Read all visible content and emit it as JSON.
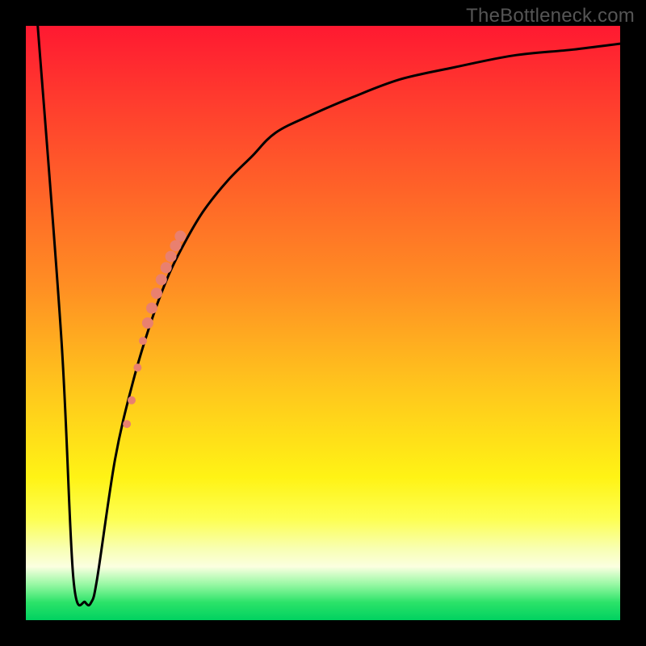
{
  "watermark": "TheBottleneck.com",
  "chart_data": {
    "type": "line",
    "title": "",
    "xlabel": "",
    "ylabel": "",
    "xlim": [
      0,
      100
    ],
    "ylim": [
      0,
      100
    ],
    "grid": false,
    "legend": false,
    "background_gradient": {
      "top": "#ff1931",
      "bottom": "#00d160",
      "stops": [
        {
          "pos": 0.0,
          "color": "#ff1931"
        },
        {
          "pos": 0.12,
          "color": "#ff3a2e"
        },
        {
          "pos": 0.28,
          "color": "#ff6428"
        },
        {
          "pos": 0.44,
          "color": "#ff8f23"
        },
        {
          "pos": 0.6,
          "color": "#ffc31d"
        },
        {
          "pos": 0.76,
          "color": "#fff315"
        },
        {
          "pos": 0.83,
          "color": "#fdff52"
        },
        {
          "pos": 0.88,
          "color": "#f8ffb3"
        },
        {
          "pos": 0.91,
          "color": "#fbffe0"
        },
        {
          "pos": 0.94,
          "color": "#97f8a3"
        },
        {
          "pos": 0.97,
          "color": "#2ce369"
        },
        {
          "pos": 1.0,
          "color": "#00d160"
        }
      ]
    },
    "series": [
      {
        "name": "bottleneck-curve",
        "color": "#000000",
        "stroke_width": 3,
        "x": [
          2,
          6,
          8,
          10,
          11,
          12,
          15,
          18,
          21,
          24,
          27,
          30,
          34,
          38,
          42,
          48,
          55,
          63,
          72,
          82,
          92,
          100
        ],
        "y": [
          100,
          47,
          7,
          3,
          3,
          7,
          27,
          40,
          50,
          58,
          64,
          69,
          74,
          78,
          82,
          85,
          88,
          91,
          93,
          95,
          96,
          97
        ]
      }
    ],
    "scatter": [
      {
        "name": "highlight-band",
        "color": "#e9806f",
        "radius_major": 7,
        "radius_minor": 5,
        "points": [
          {
            "x": 17.0,
            "y": 33.0,
            "r": 5
          },
          {
            "x": 17.8,
            "y": 37.0,
            "r": 5
          },
          {
            "x": 18.8,
            "y": 42.5,
            "r": 5
          },
          {
            "x": 19.7,
            "y": 47.0,
            "r": 5
          },
          {
            "x": 20.5,
            "y": 50.0,
            "r": 7
          },
          {
            "x": 21.2,
            "y": 52.5,
            "r": 7
          },
          {
            "x": 22.0,
            "y": 55.0,
            "r": 7
          },
          {
            "x": 22.8,
            "y": 57.3,
            "r": 7
          },
          {
            "x": 23.6,
            "y": 59.3,
            "r": 7
          },
          {
            "x": 24.4,
            "y": 61.2,
            "r": 7
          },
          {
            "x": 25.2,
            "y": 63.0,
            "r": 7
          },
          {
            "x": 26.0,
            "y": 64.6,
            "r": 7
          }
        ]
      }
    ]
  }
}
